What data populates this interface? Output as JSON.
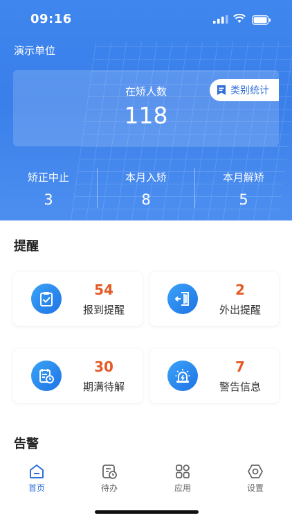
{
  "status": {
    "time": "09:16"
  },
  "header": {
    "org": "演示单位"
  },
  "summary": {
    "label": "在矫人数",
    "value": "118",
    "category_button": "类别统计"
  },
  "stats": [
    {
      "label": "矫正中止",
      "value": "3"
    },
    {
      "label": "本月入矫",
      "value": "8"
    },
    {
      "label": "本月解矫",
      "value": "5"
    }
  ],
  "reminders": {
    "title": "提醒",
    "items": [
      {
        "count": "54",
        "label": "报到提醒",
        "icon": "clipboard-check-icon"
      },
      {
        "count": "2",
        "label": "外出提醒",
        "icon": "exit-door-icon"
      },
      {
        "count": "30",
        "label": "期满待解",
        "icon": "calendar-clock-icon"
      },
      {
        "count": "7",
        "label": "警告信息",
        "icon": "alarm-light-icon"
      }
    ]
  },
  "alerts": {
    "title": "告警"
  },
  "tabbar": {
    "active": "首页",
    "items": [
      {
        "label": "首页",
        "icon": "home-icon"
      },
      {
        "label": "待办",
        "icon": "todo-icon"
      },
      {
        "label": "应用",
        "icon": "apps-icon"
      },
      {
        "label": "设置",
        "icon": "settings-icon"
      }
    ]
  },
  "colors": {
    "primary": "#3a7fea",
    "count": "#e35a25",
    "tab_active": "#2f6fd8"
  }
}
